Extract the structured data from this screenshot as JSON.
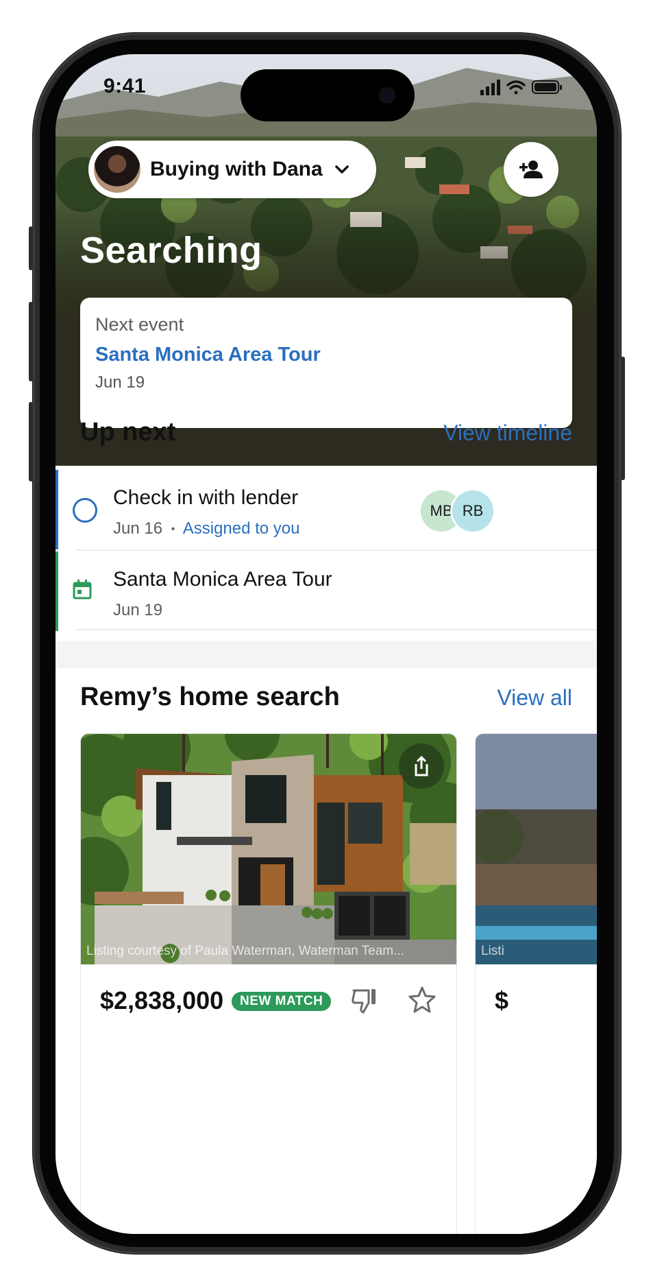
{
  "status_bar": {
    "time": "9:41"
  },
  "header": {
    "team_label": "Buying with Dana",
    "title": "Searching",
    "next_event": {
      "kicker": "Next event",
      "name": "Santa Monica Area Tour",
      "date": "Jun 19"
    }
  },
  "up_next": {
    "title": "Up next",
    "link": "View timeline",
    "items": [
      {
        "title": "Check in with lender",
        "date": "Jun 16",
        "separator": "•",
        "assignee": "Assigned to you",
        "avatars": [
          {
            "initials": "MB",
            "color": "#c6e6d0"
          },
          {
            "initials": "RB",
            "color": "#b6e3ea"
          }
        ],
        "accent": "#2a6fbf",
        "icon": "circle-checkbox-icon"
      },
      {
        "title": "Santa Monica Area Tour",
        "date": "Jun 19",
        "accent": "#2c9a5a",
        "icon": "calendar-icon"
      }
    ]
  },
  "home_search": {
    "title": "Remy’s home search",
    "link": "View all",
    "listings": [
      {
        "courtesy": "Listing courtesy of Paula Waterman, Waterman Team...",
        "price": "$2,838,000",
        "badge": "NEW MATCH"
      },
      {
        "courtesy": "Listi",
        "price": "$"
      }
    ]
  },
  "colors": {
    "link_blue": "#2a6fbf",
    "match_green": "#2c9a5a"
  }
}
